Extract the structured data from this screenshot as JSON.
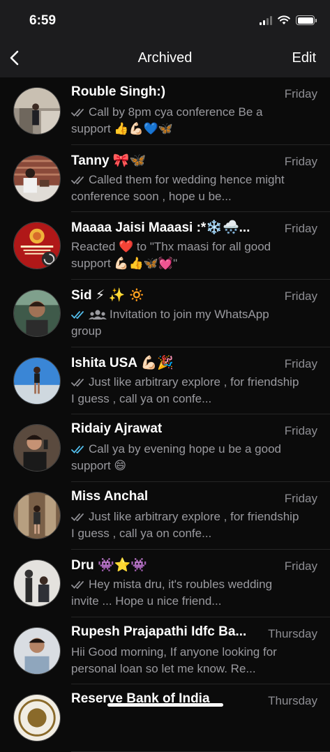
{
  "status": {
    "time": "6:59"
  },
  "nav": {
    "title": "Archived",
    "edit": "Edit"
  },
  "chats": [
    {
      "name": "Rouble Singh:)",
      "time": "Friday",
      "tick": "grey",
      "preview": "Call by 8pm cya conference  Be a support 👍💪🏻💙🦋"
    },
    {
      "name": "Tanny 🎀🦋",
      "time": "Friday",
      "tick": "grey",
      "preview": "Called them for wedding hence might conference soon , hope u be..."
    },
    {
      "name": "Maaaa Jaisi Maaasi :*❄️🌨️...",
      "time": "Friday",
      "tick": "none",
      "preview": "Reacted ❤️ to \"Thx maasi for all good support 💪🏻👍🦋💓\""
    },
    {
      "name": "Sid ⚡ ✨ 🔅",
      "time": "Friday",
      "tick": "blue",
      "group": true,
      "preview": "Invitation to join my WhatsApp group"
    },
    {
      "name": "Ishita USA 💪🏻🎉",
      "time": "Friday",
      "tick": "grey",
      "preview": "Just like arbitrary explore , for friendship I guess  , call ya on confe..."
    },
    {
      "name": "Ridaiy Ajrawat",
      "time": "Friday",
      "tick": "blue",
      "preview": "Call ya by evening hope u be a good support 😄"
    },
    {
      "name": "Miss Anchal",
      "time": "Friday",
      "tick": "grey",
      "preview": "Just like arbitrary explore , for friendship I guess  , call ya on confe..."
    },
    {
      "name": "Dru 👾⭐👾",
      "time": "Friday",
      "tick": "grey",
      "preview": "Hey mista dru, it's roubles wedding invite ... Hope u nice friend..."
    },
    {
      "name": "Rupesh Prajapathi Idfc Ba...",
      "time": "Thursday",
      "tick": "none",
      "preview": "Hii Good morning, If anyone looking for personal loan so let me know. Re..."
    },
    {
      "name": "Reserve Bank of India",
      "time": "Thursday",
      "tick": "none",
      "preview": ""
    }
  ],
  "colors": {
    "tick_grey": "#8e8e93",
    "tick_blue": "#53bdeb",
    "background": "#0b0b0b",
    "bar": "#1c1c1e"
  },
  "icons": {
    "back": "chevron-left-icon",
    "wifi": "wifi-icon",
    "signal": "cellular-signal-icon",
    "battery": "battery-icon"
  }
}
